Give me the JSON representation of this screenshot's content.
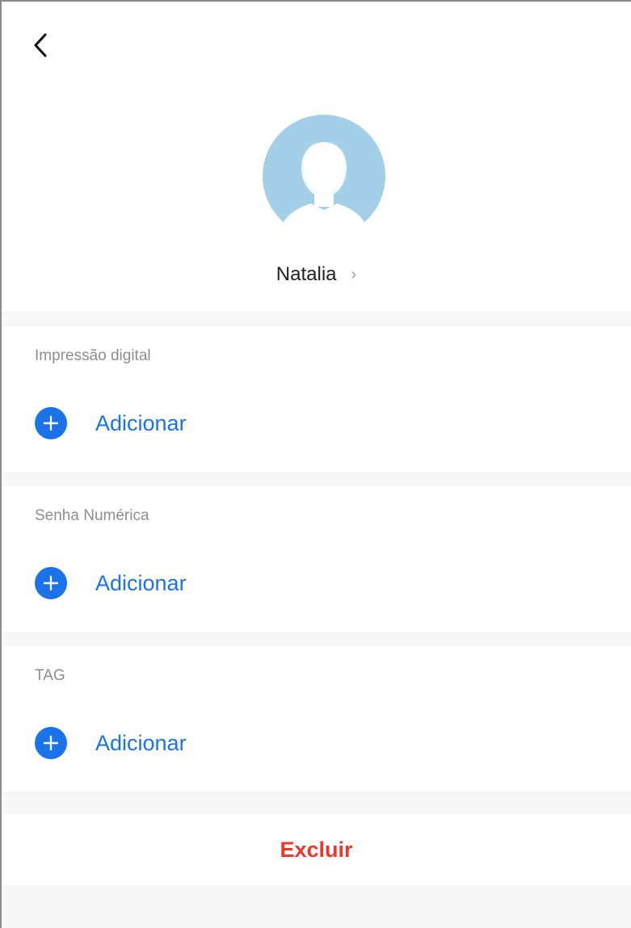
{
  "header": {
    "back_icon": "chevron-left-icon",
    "avatar_icon": "user-avatar-icon",
    "user_name": "Natalia",
    "name_chevron": "›"
  },
  "sections": [
    {
      "title": "Impressão digital",
      "add_label": "Adicionar",
      "icon": "plus-circle-icon"
    },
    {
      "title": "Senha Numérica",
      "add_label": "Adicionar",
      "icon": "plus-circle-icon"
    },
    {
      "title": "TAG",
      "add_label": "Adicionar",
      "icon": "plus-circle-icon"
    }
  ],
  "delete": {
    "label": "Excluir"
  },
  "colors": {
    "accent": "#1a73e8",
    "danger": "#f0352b",
    "avatar": "#a3cfe8",
    "background": "#f7f7f7"
  }
}
